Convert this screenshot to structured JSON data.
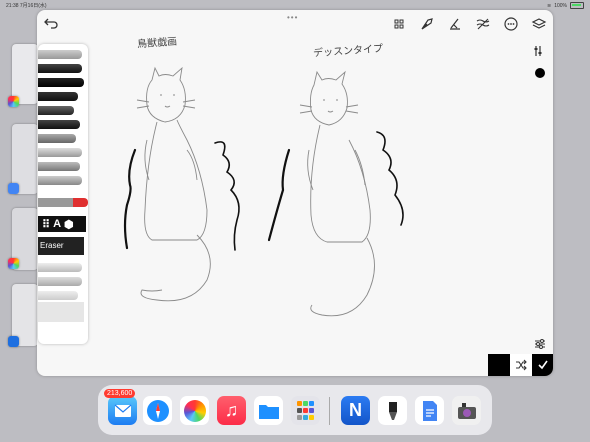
{
  "status_bar": {
    "time": "21:38",
    "date": "7月16日(水)",
    "battery": "100%"
  },
  "annotations": {
    "left": "鳥獣戯画",
    "right": "デッスンタイプ"
  },
  "tools": {
    "back": "back-arrow-icon",
    "top": [
      "grid-icon",
      "pen-nib-icon",
      "ruler-pen-icon",
      "wave-stroke-icon",
      "more-circle-icon",
      "layers-icon"
    ],
    "current_color": "#000000"
  },
  "brush_panel": {
    "picker_glyphs": [
      "⠿",
      "A"
    ],
    "eraser_label": "Eraser"
  },
  "dock": {
    "mail_badge": "213,600",
    "apps": [
      "Mail",
      "Safari",
      "Photos",
      "Music",
      "Files",
      "Utilities",
      "Notes App",
      "Brush App",
      "Docs",
      "Camera Tools"
    ]
  },
  "colors": {
    "accent": "#000000",
    "panel": "#f7f7f7",
    "background": "#bdbdc2"
  }
}
